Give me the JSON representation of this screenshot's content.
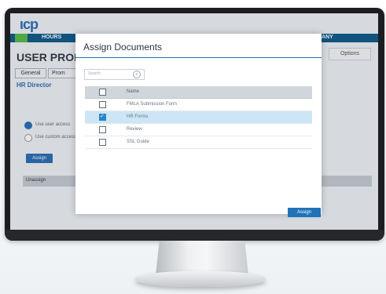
{
  "app": {
    "logo": "ιcp",
    "nav_hours": "HOURS",
    "nav_company_fragment": "ANY",
    "page_title": "USER PROFI",
    "options_label": "Options",
    "tabs": [
      "General",
      "Prom"
    ],
    "section_title": "HR Director",
    "radio_options": [
      "Use user access",
      "Use custom access"
    ],
    "assign_button": "Assign",
    "unassign_label": "Unassign"
  },
  "modal": {
    "title": "Assign Documents",
    "filter_placeholder": "Search",
    "filter_icon": "search-icon",
    "table": {
      "header": "Name",
      "rows": [
        {
          "label": "FMLA Submission Form",
          "checked": false
        },
        {
          "label": "HR Forms",
          "checked": true
        },
        {
          "label": "Review",
          "checked": false
        },
        {
          "label": "SSL Guide",
          "checked": false
        }
      ]
    },
    "assign_label": "Assign"
  },
  "colors": {
    "accent": "#1e73b8",
    "nav_bar": "#0e5a8a",
    "nav_green": "#56b947",
    "selected_row": "#cde6f6",
    "header_row": "#d1d6db"
  }
}
